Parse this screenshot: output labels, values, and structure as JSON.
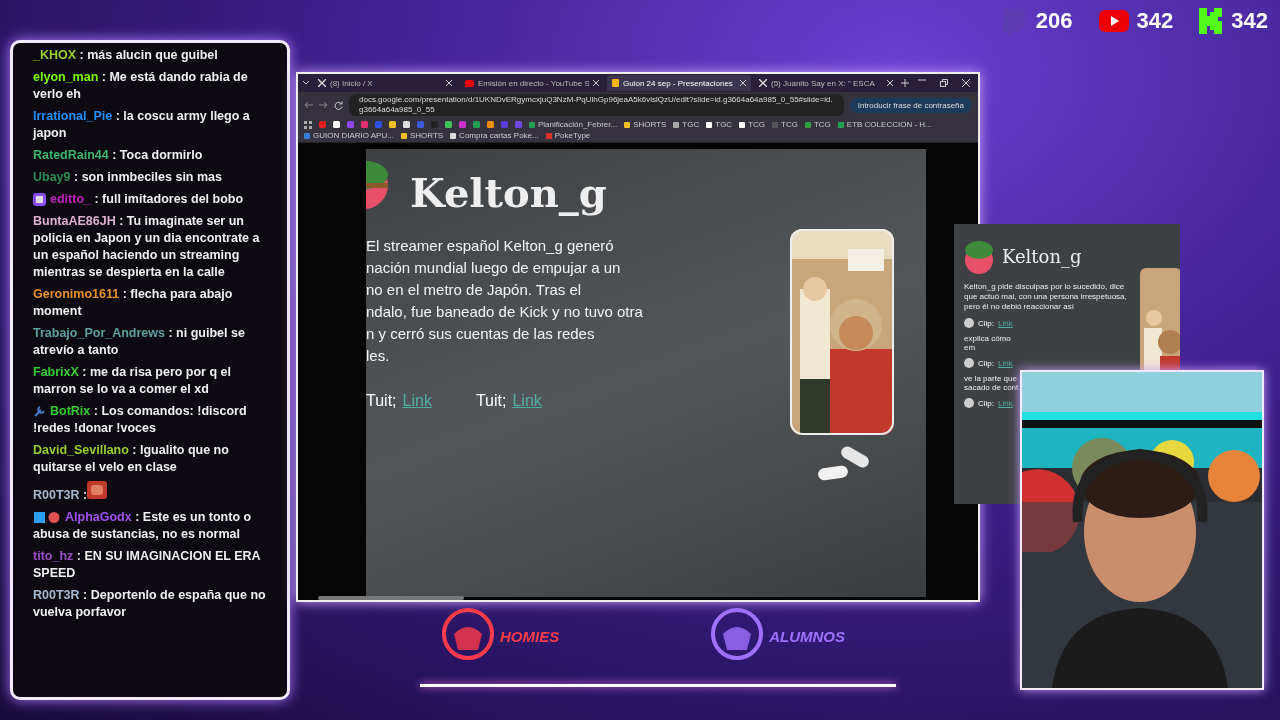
{
  "counters": [
    {
      "kind": "twitch",
      "value": "206"
    },
    {
      "kind": "youtube",
      "value": "342"
    },
    {
      "kind": "kick",
      "value": "342"
    }
  ],
  "chat": [
    {
      "kind": "plain",
      "user": "_KHOX",
      "color": "#9acd32",
      "text": ": más alucin que guibel"
    },
    {
      "kind": "plain",
      "user": "elyon_man",
      "color": "#7cfc00",
      "text": ": Me está dando rabia de verlo eh"
    },
    {
      "kind": "plain",
      "user": "Irrational_Pie",
      "color": "#1e90ff",
      "text": ": la coscu army llego a japon"
    },
    {
      "kind": "plain",
      "user": "RatedRain44",
      "color": "#3cb371",
      "text": ": Toca dormirlo"
    },
    {
      "kind": "plain",
      "user": "Ubay9",
      "color": "#2e8b57",
      "text": ": son inmbeciles sin mas"
    },
    {
      "kind": "sub",
      "user": "editto_",
      "color": "#c020c0",
      "text": ": full imitadores del bobo"
    },
    {
      "kind": "plain",
      "user": "BuntaAE86JH",
      "color": "#e0b0d0",
      "text": ": Tu imaginate ser un policia en Japon y un dia encontrate a un español haciendo un streaming mientras se despierta en la calle"
    },
    {
      "kind": "plain",
      "user": "Geronimo1611",
      "color": "#e8902a",
      "text": ": flecha para abajo moment"
    },
    {
      "kind": "plain",
      "user": "Trabajo_Por_Andrews",
      "color": "#5f9ea0",
      "text": ": ni guibel se atrevío a tanto"
    },
    {
      "kind": "plain",
      "user": "FabrixX",
      "color": "#32cd32",
      "text": ": me da risa pero por q el marron se lo va a comer el xd"
    },
    {
      "kind": "bot",
      "user": "BotRix",
      "color": "#32cd32",
      "text": ": Los comandos: !discord !redes !donar !voces"
    },
    {
      "kind": "plain",
      "user": "David_Sevillano",
      "color": "#9acd32",
      "text": ": Igualito que no quitarse el velo en clase"
    },
    {
      "kind": "emote",
      "user": "R00T3R",
      "color": "#a9b7d0",
      "text": ":"
    },
    {
      "kind": "gems",
      "user": "AlphaGodx",
      "color": "#a050f0",
      "text": ": Este es un tonto o abusa de sustancias, no es normal"
    },
    {
      "kind": "plain",
      "user": "tito_hz",
      "color": "#9b4dca",
      "text": ": EN SU IMAGINACION EL ERA SPEED"
    },
    {
      "kind": "plain",
      "user": "R00T3R",
      "color": "#a9b7d0",
      "text": ": Deportenlo de españa que no vuelva porfavor"
    }
  ],
  "browser": {
    "tabs": [
      {
        "kind": "x",
        "title": "(8) Inicio / X",
        "selected": false
      },
      {
        "kind": "youtube",
        "title": "Emisión en directo - YouTube S",
        "selected": false
      },
      {
        "kind": "slides",
        "title": "Guion 24 sep - Presentaciones",
        "selected": true
      },
      {
        "kind": "x",
        "title": "(5) Juanito Say en X: \" ESCA",
        "selected": false
      }
    ],
    "url": "docs.google.com/presentation/d/1UKNDvERgymcxjuQ3NzM-PqUlhGp96jeaA5k6vlslQzU/edit?slide=id.g3664a64a985_0_55#slide=id.g3664a64a985_0_55",
    "passphrase_button": "Introducir frase de contraseña",
    "bookmarks": [
      {
        "kind": "icon",
        "color": "#e02020"
      },
      {
        "kind": "icon",
        "color": "#ffffff"
      },
      {
        "kind": "icon",
        "color": "#9146ff"
      },
      {
        "kind": "icon",
        "color": "#e1306c"
      },
      {
        "kind": "icon",
        "color": "#3050e0"
      },
      {
        "kind": "icon",
        "color": "#f0c020"
      },
      {
        "kind": "icon",
        "color": "#dddddd"
      },
      {
        "kind": "icon",
        "color": "#3b5bdb"
      },
      {
        "kind": "icon",
        "color": "#222222"
      },
      {
        "kind": "icon",
        "color": "#40c057"
      },
      {
        "kind": "icon",
        "color": "#cc33cc"
      },
      {
        "kind": "icon",
        "color": "#20a050"
      },
      {
        "kind": "icon",
        "color": "#f08c00"
      },
      {
        "kind": "icon",
        "color": "#5c3bdb"
      },
      {
        "kind": "icon",
        "color": "#7048e8"
      },
      {
        "kind": "labeled",
        "color": "#20a050",
        "label": "Planificación_Febrer..."
      },
      {
        "kind": "labeled",
        "color": "#f0c020",
        "label": "SHORTS"
      },
      {
        "kind": "labeled",
        "color": "#aaaaaa",
        "label": "TGC"
      },
      {
        "kind": "labeled",
        "color": "#ffffff",
        "label": "TGC"
      },
      {
        "kind": "labeled",
        "color": "#ffffff",
        "label": "TCG"
      },
      {
        "kind": "labeled",
        "color": "#555555",
        "label": "TCG"
      },
      {
        "kind": "labeled",
        "color": "#2f9e44",
        "label": "TCG"
      },
      {
        "kind": "labeled",
        "color": "#20a050",
        "label": "ETB COLECCION - H..."
      },
      {
        "kind": "labeled",
        "color": "#3b7bdb",
        "label": "GUION DIARIO APU..."
      },
      {
        "kind": "labeled",
        "color": "#f0c020",
        "label": "SHORTS"
      },
      {
        "kind": "labeled",
        "color": "#dddddd",
        "label": "Compra cartas Poke..."
      },
      {
        "kind": "labeled",
        "color": "#e03131",
        "label": "PokeType"
      }
    ]
  },
  "slide": {
    "title": "Kelton_g",
    "lines": [
      "El streamer español Kelton_g generó",
      "nación mundial luego de empujar a un",
      "no en el metro de Japón. Tras el",
      "ndalo, fue baneado de Kick y no tuvo otra",
      "n y cerró sus cuentas de las redes",
      "les."
    ],
    "tuits": [
      {
        "label": "Tuit;",
        "link": "Link"
      },
      {
        "label": "Tuit;",
        "link": "Link"
      }
    ]
  },
  "next_slide": {
    "title": "Kelton_g",
    "text": "Kelton_g pide disculpas por lo sucedido, dice que actuó mal, con una persona irrespetuosa, pero él no debió reaccionar así",
    "items": [
      {
        "kind": "clip",
        "label": "Clip:",
        "link": "Link"
      },
      {
        "kind": "note",
        "text": "explica cómo em"
      },
      {
        "kind": "clip",
        "label": "Clip:",
        "link": "Link"
      },
      {
        "kind": "note",
        "text": "ve la parte que sacado de cont"
      },
      {
        "kind": "clip",
        "label": "Clip:",
        "link": "Link"
      }
    ]
  },
  "logos": [
    {
      "label": "HOMIES",
      "color": "#ff3b4a"
    },
    {
      "label": "ALUMNOS",
      "color": "#a070ff"
    }
  ]
}
